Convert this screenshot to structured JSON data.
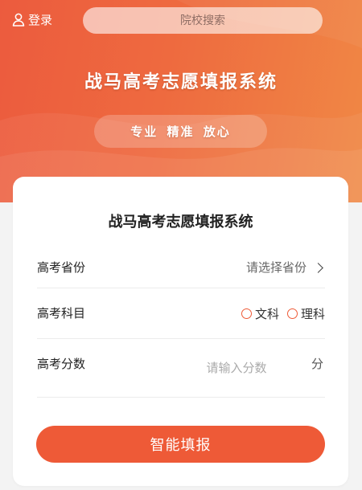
{
  "header": {
    "login_label": "登录",
    "login_icon": "user-icon",
    "search_placeholder": "院校搜索",
    "title": "战马高考志愿填报系统",
    "slogan": "专业 精准 放心"
  },
  "form": {
    "title": "战马高考志愿填报系统",
    "province": {
      "label": "高考省份",
      "placeholder": "请选择省份",
      "icon": "chevron-right-icon"
    },
    "subject": {
      "label": "高考科目",
      "options": [
        "文科",
        "理科"
      ]
    },
    "score": {
      "label": "高考分数",
      "placeholder": "请输入分数",
      "unit": "分"
    },
    "submit_label": "智能填报"
  },
  "colors": {
    "accent": "#ee5a37",
    "hero_start": "#ec5b3e",
    "hero_end": "#f08845"
  }
}
